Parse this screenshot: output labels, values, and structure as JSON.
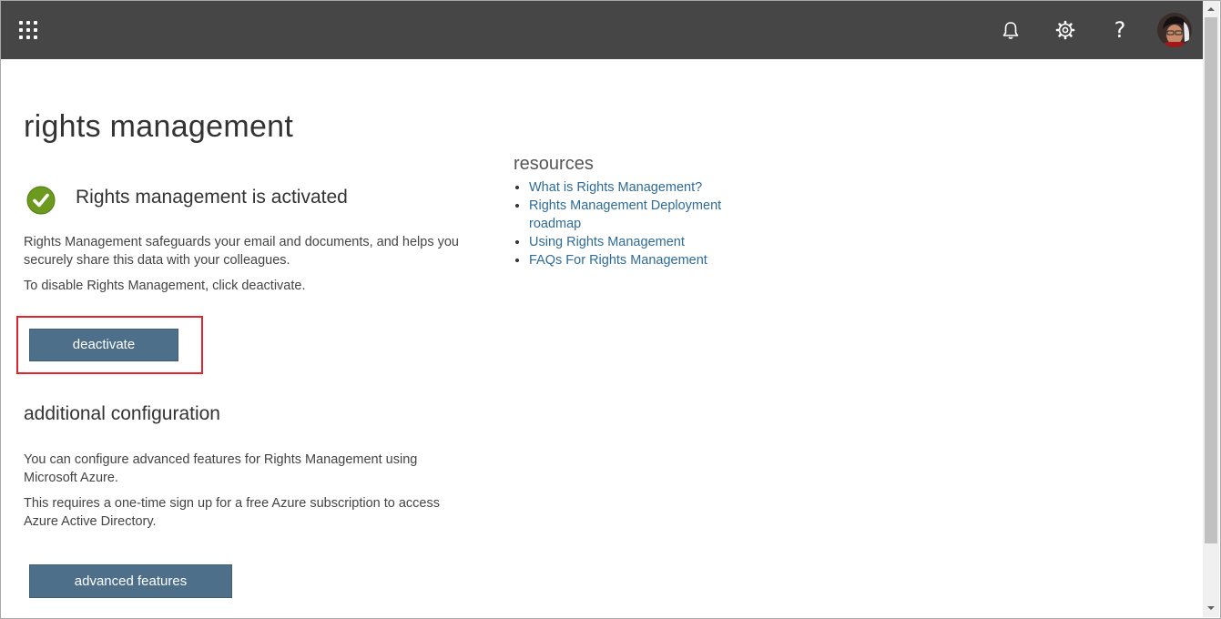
{
  "header": {
    "icons": {
      "app_launcher": "waffle-icon",
      "notifications": "bell-icon",
      "settings": "gear-icon",
      "help": "help-icon",
      "help_glyph": "?",
      "account": "avatar"
    },
    "colors": {
      "bar": "#474646",
      "icon": "#ffffff"
    }
  },
  "main": {
    "title": "rights management",
    "status": {
      "icon": "checkmark-circle-icon",
      "text": "Rights management is activated",
      "color": "#6b9a1f"
    },
    "description": "Rights Management safeguards your email and documents, and helps you securely share this data with your colleagues.",
    "disable_hint": "To disable Rights Management, click deactivate.",
    "deactivate_label": "deactivate",
    "additional": {
      "title": "additional configuration",
      "text1": "You can configure advanced features for Rights Management using Microsoft Azure.",
      "text2": "This requires a one-time sign up for a free Azure subscription to access Azure Active Directory.",
      "button_label": "advanced features"
    },
    "button_color": "#4d6f8a",
    "highlight_color": "#e0252f"
  },
  "resources": {
    "title": "resources",
    "links": [
      "What is Rights Management?",
      "Rights Management Deployment roadmap",
      "Using Rights Management",
      "FAQs For Rights Management"
    ],
    "link_color": "#2e6b98"
  }
}
